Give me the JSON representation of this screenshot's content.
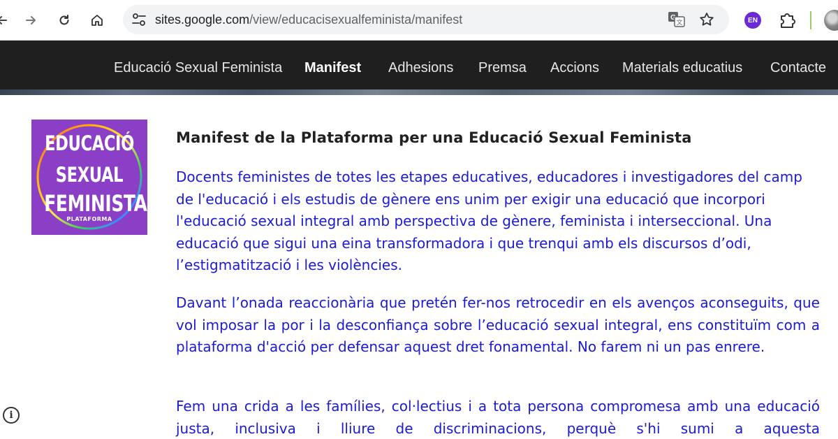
{
  "browser": {
    "url_host": "sites.google.com",
    "url_path": "/view/educacisexualfeminista/manifest",
    "extension_badge": "EN",
    "icons": [
      "back-icon",
      "forward-icon",
      "reload-icon",
      "home-icon",
      "site-settings-icon",
      "translate-icon",
      "bookmark-star-icon",
      "extensions-icon",
      "profile-avatar"
    ]
  },
  "site_nav": {
    "items": [
      {
        "label": "Educació Sexual Feminista",
        "active": false
      },
      {
        "label": "Manifest",
        "active": true
      },
      {
        "label": "Adhesions",
        "active": false
      },
      {
        "label": "Premsa",
        "active": false
      },
      {
        "label": "Accions",
        "active": false
      },
      {
        "label": "Materials educatius",
        "active": false
      },
      {
        "label": "Contacte",
        "active": false
      }
    ]
  },
  "logo": {
    "line1": "EDUCACIÓ",
    "line2": "SEXUAL",
    "line3": "FEMINISTA",
    "line4": "PLATAFORMA",
    "background_color": "#8b3fc6"
  },
  "content": {
    "title": "Manifest de la Plataforma per una Educació Sexual Feminista",
    "paragraphs": [
      "Docents feministes de totes les etapes educatives, educadores i investigadores del camp de l'educació i els estudis de gènere ens unim per exigir una educació que incorpori l'educació sexual integral amb perspectiva de gènere, feminista i interseccional. Una educació que sigui una eina transformadora i que trenqui amb els discursos d’odi, l’estigmatització i les violències.",
      "Davant l’onada reaccionària que pretén fer-nos retrocedir en els avenços aconseguits, que vol imposar la por i la desconfiança sobre l’educació sexual integral, ens constituïm com a plataforma d'acció per defensar aquest dret fonamental. No farem ni un pas enrere.",
      "Fem una crida a les famílies, col·lectius i a tota persona compromesa amb una educació justa, inclusiva i lliure de discriminacions, perquè s'hi sumi a aquesta"
    ],
    "text_color": "#1b1bd6"
  },
  "footer": {
    "info_glyph": "i"
  }
}
